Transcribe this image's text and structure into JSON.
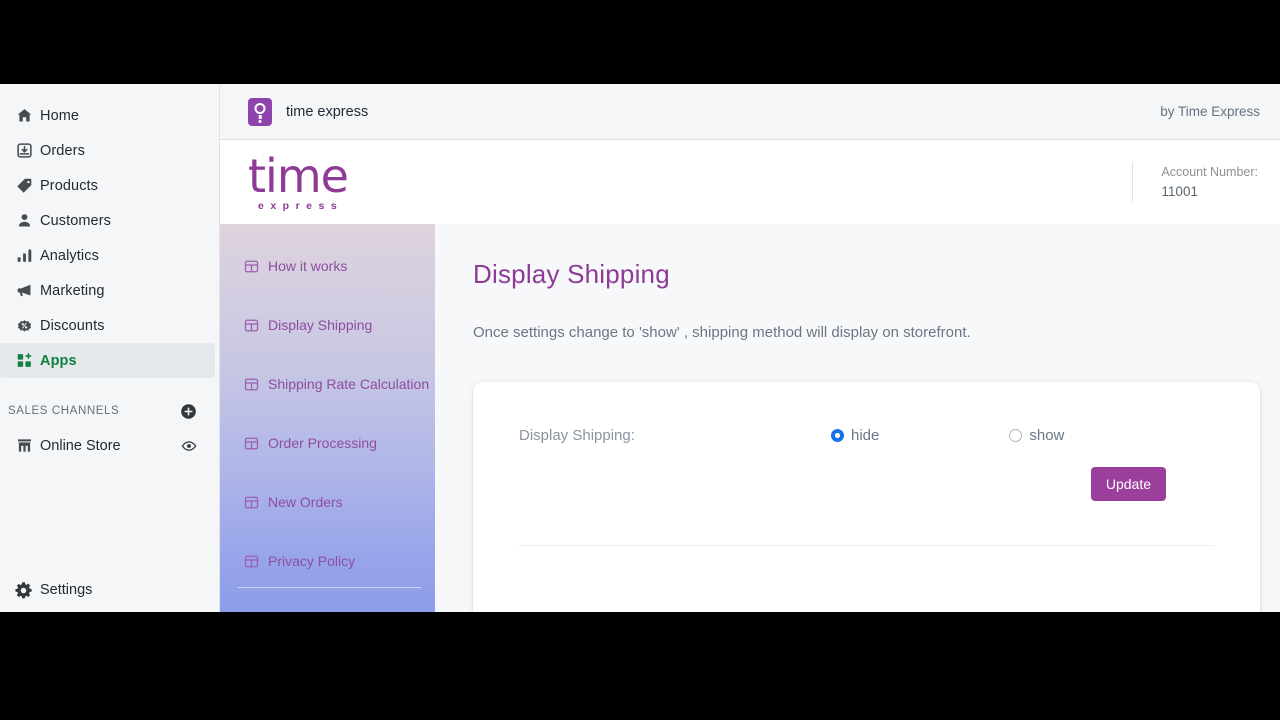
{
  "shopify_sidebar": {
    "nav_items": [
      {
        "label": "Home",
        "icon": "home-icon",
        "active": false
      },
      {
        "label": "Orders",
        "icon": "orders-inbox-icon",
        "active": false
      },
      {
        "label": "Products",
        "icon": "product-tag-icon",
        "active": false
      },
      {
        "label": "Customers",
        "icon": "customer-person-icon",
        "active": false
      },
      {
        "label": "Analytics",
        "icon": "analytics-bars-icon",
        "active": false
      },
      {
        "label": "Marketing",
        "icon": "marketing-megaphone-icon",
        "active": false
      },
      {
        "label": "Discounts",
        "icon": "discount-percent-icon",
        "active": false
      },
      {
        "label": "Apps",
        "icon": "apps-grid-plus-icon",
        "active": true
      }
    ],
    "sales_channels": {
      "heading": "SALES CHANNELS",
      "add_icon": "plus-circle-icon",
      "items": [
        {
          "label": "Online Store",
          "icon": "storefront-icon",
          "action_icon": "eye-icon"
        }
      ]
    },
    "settings": {
      "label": "Settings",
      "icon": "gear-icon"
    },
    "active_accent_color": "#108043"
  },
  "app_bar": {
    "icon": "time-express-app-icon",
    "title": "time express",
    "by_line": "by Time Express"
  },
  "brand_header": {
    "logo_main": "time",
    "logo_sub": "express",
    "logo_color": "#8e3a96",
    "account_label": "Account Number:",
    "account_value": "11001"
  },
  "app_menu": {
    "items": [
      {
        "label": "How it works",
        "icon": "table-grid-icon"
      },
      {
        "label": "Display Shipping",
        "icon": "table-grid-icon"
      },
      {
        "label": "Shipping Rate Calculation",
        "icon": "table-grid-icon"
      },
      {
        "label": "Order Processing",
        "icon": "table-grid-icon"
      },
      {
        "label": "New Orders",
        "icon": "table-grid-icon"
      },
      {
        "label": "Privacy Policy",
        "icon": "table-grid-icon"
      }
    ],
    "item_color": "#8e4e9e"
  },
  "content": {
    "title": "Display Shipping",
    "description": "Once settings change to 'show' , shipping method will display on storefront.",
    "form": {
      "label": "Display Shipping:",
      "options": [
        {
          "label": "hide",
          "value": "hide",
          "checked": true
        },
        {
          "label": "show",
          "value": "show",
          "checked": false
        }
      ],
      "selected": "hide",
      "submit_label": "Update",
      "submit_color": "#9c3e9c",
      "radio_accent_color": "#1473e6"
    }
  }
}
